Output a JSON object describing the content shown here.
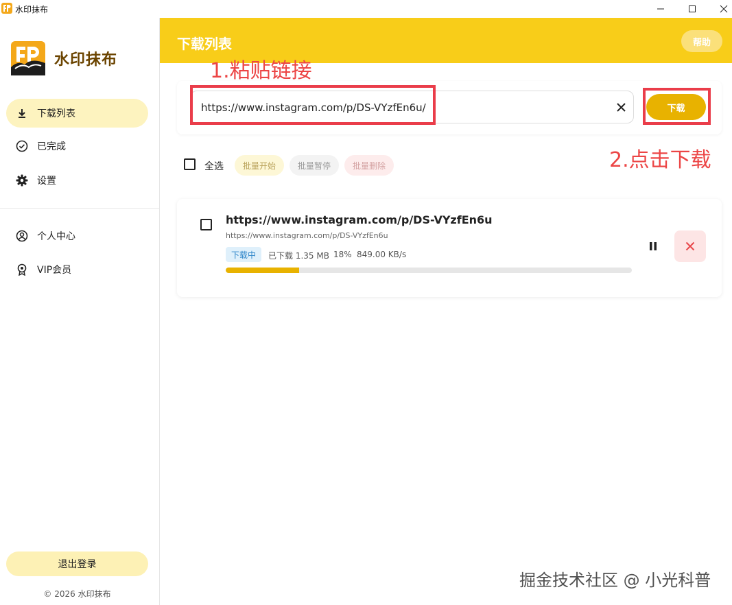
{
  "window": {
    "title": "水印抹布",
    "controls": [
      "minimize-icon",
      "maximize-icon",
      "close-icon"
    ]
  },
  "sidebar": {
    "brand_name": "水印抹布",
    "items": [
      {
        "label": "下载列表",
        "icon": "download-icon",
        "active": true
      },
      {
        "label": "已完成",
        "icon": "check-circle-icon",
        "active": false
      },
      {
        "label": "设置",
        "icon": "gear-icon",
        "active": false
      },
      {
        "label": "个人中心",
        "icon": "user-circle-icon",
        "active": false
      },
      {
        "label": "VIP会员",
        "icon": "vip-badge-icon",
        "active": false
      }
    ],
    "logout_label": "退出登录",
    "copyright": "© 2026 水印抹布"
  },
  "header": {
    "title": "下载列表",
    "help_label": "帮助"
  },
  "annotations": {
    "step1": "1.粘贴链接",
    "step2": "2.点击下载"
  },
  "input": {
    "value": "https://www.instagram.com/p/DS-VYzfEn6u/",
    "download_label": "下载"
  },
  "toolbar": {
    "select_all": "全选",
    "batch_start": "批量开始",
    "batch_pause": "批量暂停",
    "batch_delete": "批量删除"
  },
  "task": {
    "title": "https://www.instagram.com/p/DS-VYzfEn6u",
    "url": "https://www.instagram.com/p/DS-VYzfEn6u",
    "status": "下载中",
    "downloaded": "已下载 1.35 MB",
    "percent_label": "18%",
    "speed": "849.00 KB/s",
    "progress": 0.18
  },
  "watermark": "掘金技术社区 @ 小光科普",
  "colors": {
    "accent": "#f8cd19",
    "button": "#e8b200",
    "annotation": "#ec4545",
    "nav_active": "#fdf3bf",
    "status_badge": "#2f86c9"
  }
}
